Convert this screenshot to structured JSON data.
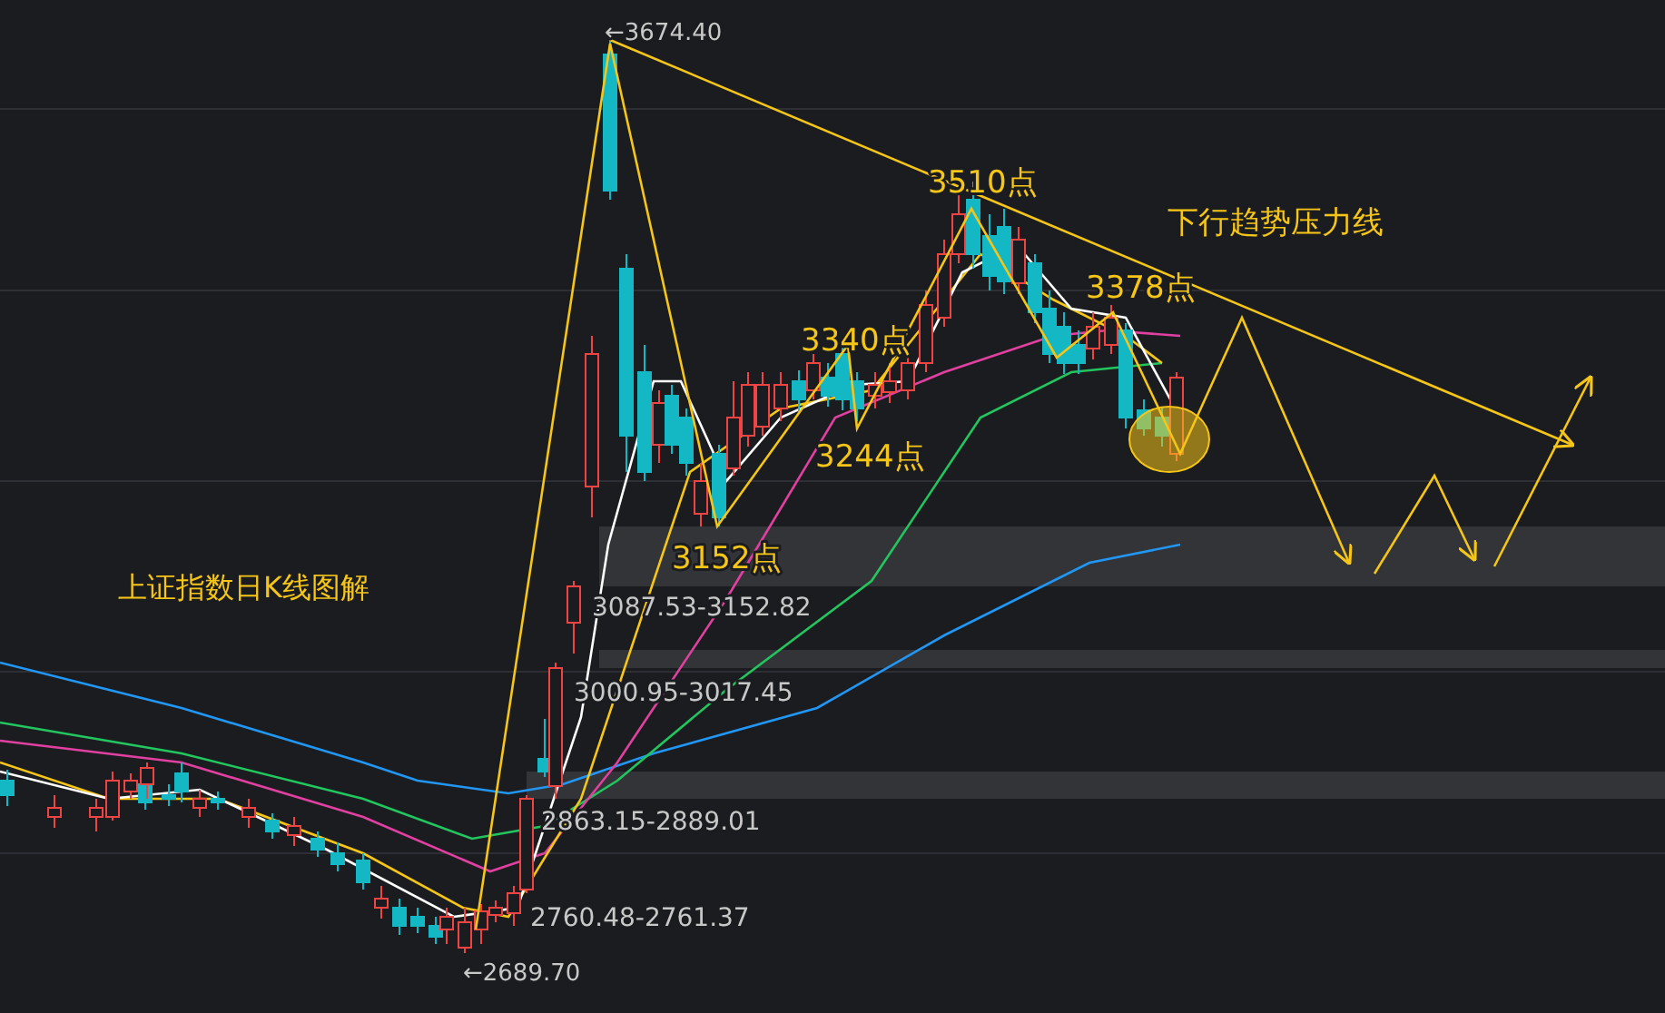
{
  "chart_title": "上证指数日K线图解",
  "trend_label": "下行趋势压力线",
  "point_labels": [
    "3510点",
    "3378点",
    "3340点",
    "3244点",
    "3152点"
  ],
  "extreme_labels": [
    "←3674.40",
    "←2689.70"
  ],
  "range_labels": [
    "3087.53-3152.82",
    "3000.95-3017.45",
    "2863.15-2889.01",
    "2760.48-2761.37"
  ]
}
